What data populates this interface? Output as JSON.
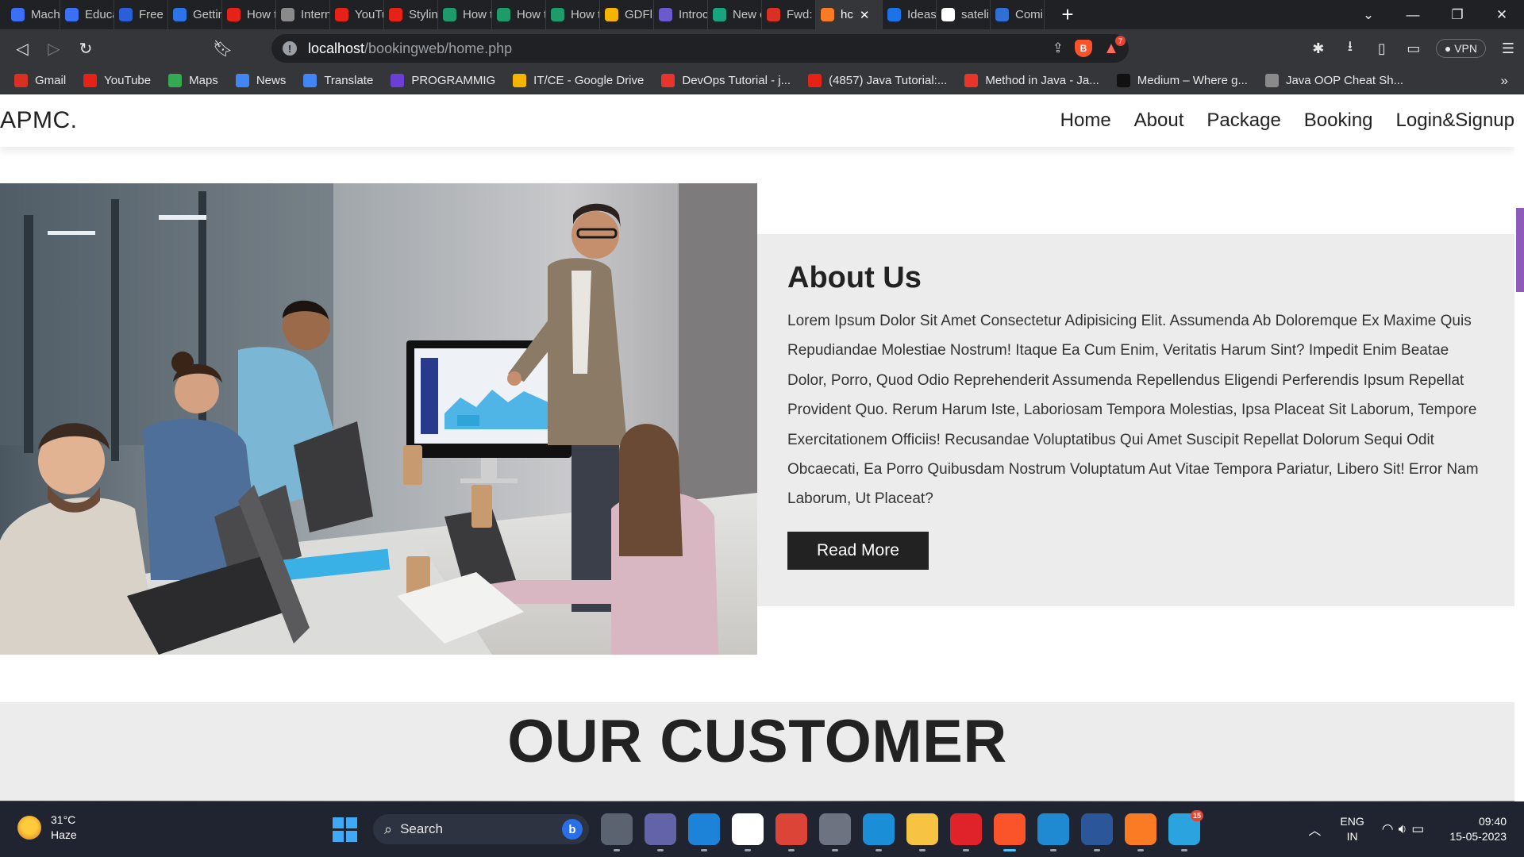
{
  "browser": {
    "tabs": [
      {
        "label": "Mach",
        "color": "#3b6ff5",
        "icon": "educative-icon"
      },
      {
        "label": "Educa",
        "color": "#3b6ff5",
        "icon": "educative-icon"
      },
      {
        "label": "Free F",
        "color": "#2b5fd9",
        "icon": "freecodecamp-icon"
      },
      {
        "label": "Gettin",
        "color": "#2a73e8",
        "icon": "getting-started-icon"
      },
      {
        "label": "How t",
        "color": "#e62117",
        "icon": "youtube-icon"
      },
      {
        "label": "Intern",
        "color": "#8a8a8a",
        "icon": "globe-icon"
      },
      {
        "label": "YouTu",
        "color": "#e62117",
        "icon": "youtube-icon"
      },
      {
        "label": "Stylin",
        "color": "#e62117",
        "icon": "youtube-icon"
      },
      {
        "label": "How t",
        "color": "#1e9b6b",
        "icon": "gfg-icon"
      },
      {
        "label": "How t",
        "color": "#1e9b6b",
        "icon": "gfg-icon"
      },
      {
        "label": "How t",
        "color": "#1e9b6b",
        "icon": "gfg-icon"
      },
      {
        "label": "GDFli",
        "color": "#f4b400",
        "icon": "google-drive-icon"
      },
      {
        "label": "Introc",
        "color": "#6a5acd",
        "icon": "intro-icon"
      },
      {
        "label": "New c",
        "color": "#19a37f",
        "icon": "chatgpt-icon"
      },
      {
        "label": "Fwd: I",
        "color": "#d93025",
        "icon": "gmail-icon"
      },
      {
        "label": "hc",
        "color": "#fb7a24",
        "icon": "xampp-icon",
        "active": true
      },
      {
        "label": "Ideas",
        "color": "#1a73e8",
        "icon": "ideas-icon"
      },
      {
        "label": "sateli",
        "color": "#ffffff",
        "icon": "google-icon"
      },
      {
        "label": "Comi",
        "color": "#2f6fd6",
        "icon": "w-icon"
      }
    ],
    "url_host": "localhost",
    "url_path": "/bookingweb/home.php",
    "vpn_label": "VPN",
    "rewards_badge": "7",
    "bookmarks": [
      {
        "label": "Gmail",
        "color": "#d93025",
        "icon": "gmail-icon"
      },
      {
        "label": "YouTube",
        "color": "#e62117",
        "icon": "youtube-icon"
      },
      {
        "label": "Maps",
        "color": "#34a853",
        "icon": "maps-icon"
      },
      {
        "label": "News",
        "color": "#4285f4",
        "icon": "news-icon"
      },
      {
        "label": "Translate",
        "color": "#4285f4",
        "icon": "translate-icon"
      },
      {
        "label": "PROGRAMMIG",
        "color": "#6b3fd6",
        "icon": "programming-icon"
      },
      {
        "label": "IT/CE - Google Drive",
        "color": "#f4b400",
        "icon": "google-drive-icon"
      },
      {
        "label": "DevOps Tutorial - j...",
        "color": "#e8342a",
        "icon": "javatpoint-icon"
      },
      {
        "label": "(4857) Java Tutorial:...",
        "color": "#e62117",
        "icon": "youtube-icon"
      },
      {
        "label": "Method in Java - Ja...",
        "color": "#e8342a",
        "icon": "javatpoint-icon"
      },
      {
        "label": "Medium – Where g...",
        "color": "#111111",
        "icon": "medium-icon"
      },
      {
        "label": "Java OOP Cheat Sh...",
        "color": "#8a8a8a",
        "icon": "globe-icon"
      }
    ]
  },
  "site": {
    "logo": "APMC.",
    "nav": [
      "Home",
      "About",
      "Package",
      "Booking",
      "Login&Signup"
    ],
    "about": {
      "heading": "About Us",
      "body": "Lorem Ipsum Dolor Sit Amet Consectetur Adipisicing Elit. Assumenda Ab Doloremque Ex Maxime Quis Repudiandae Molestiae Nostrum! Itaque Ea Cum Enim, Veritatis Harum Sint? Impedit Enim Beatae Dolor, Porro, Quod Odio Reprehenderit Assumenda Repellendus Eligendi Perferendis Ipsum Repellat Provident Quo. Rerum Harum Iste, Laboriosam Tempora Molestias, Ipsa Placeat Sit Laborum, Tempore Exercitationem Officiis! Recusandae Voluptatibus Qui Amet Suscipit Repellat Dolorum Sequi Odit Obcaecati, Ea Porro Quibusdam Nostrum Voluptatum Aut Vitae Tempora Pariatur, Libero Sit! Error Nam Laborum, Ut Placeat?",
      "button": "Read More",
      "image_alt": "team-meeting-photo"
    },
    "customer_heading": "OUR CUSTOMER"
  },
  "taskbar": {
    "weather_temp": "31°C",
    "weather_desc": "Haze",
    "search_label": "Search",
    "apps": [
      {
        "name": "file-explorer-multitask",
        "color": "#5b6270",
        "icon": "task-view-icon"
      },
      {
        "name": "teams",
        "color": "#6264a7",
        "icon": "teams-icon"
      },
      {
        "name": "help",
        "color": "#1d83d8",
        "icon": "help-icon"
      },
      {
        "name": "word-app",
        "color": "#ffffff",
        "icon": "paint-icon"
      },
      {
        "name": "chrome",
        "color": "#db4437",
        "icon": "chrome-icon"
      },
      {
        "name": "settings",
        "color": "#6d7380",
        "icon": "settings-icon"
      },
      {
        "name": "edge",
        "color": "#1a8fd8",
        "icon": "edge-icon"
      },
      {
        "name": "file-explorer",
        "color": "#f6c343",
        "icon": "folder-icon"
      },
      {
        "name": "opera",
        "color": "#e0232a",
        "icon": "opera-icon"
      },
      {
        "name": "brave",
        "color": "#fb542b",
        "icon": "brave-icon",
        "active": true
      },
      {
        "name": "vscode",
        "color": "#1f8ad2",
        "icon": "vscode-icon"
      },
      {
        "name": "word",
        "color": "#2b579a",
        "icon": "word-icon"
      },
      {
        "name": "xampp",
        "color": "#fb7a24",
        "icon": "xampp-icon"
      },
      {
        "name": "telegram",
        "color": "#2aa3df",
        "icon": "telegram-icon",
        "badge": "15"
      }
    ],
    "lang_top": "ENG",
    "lang_bottom": "IN",
    "time": "09:40",
    "date": "15-05-2023"
  }
}
